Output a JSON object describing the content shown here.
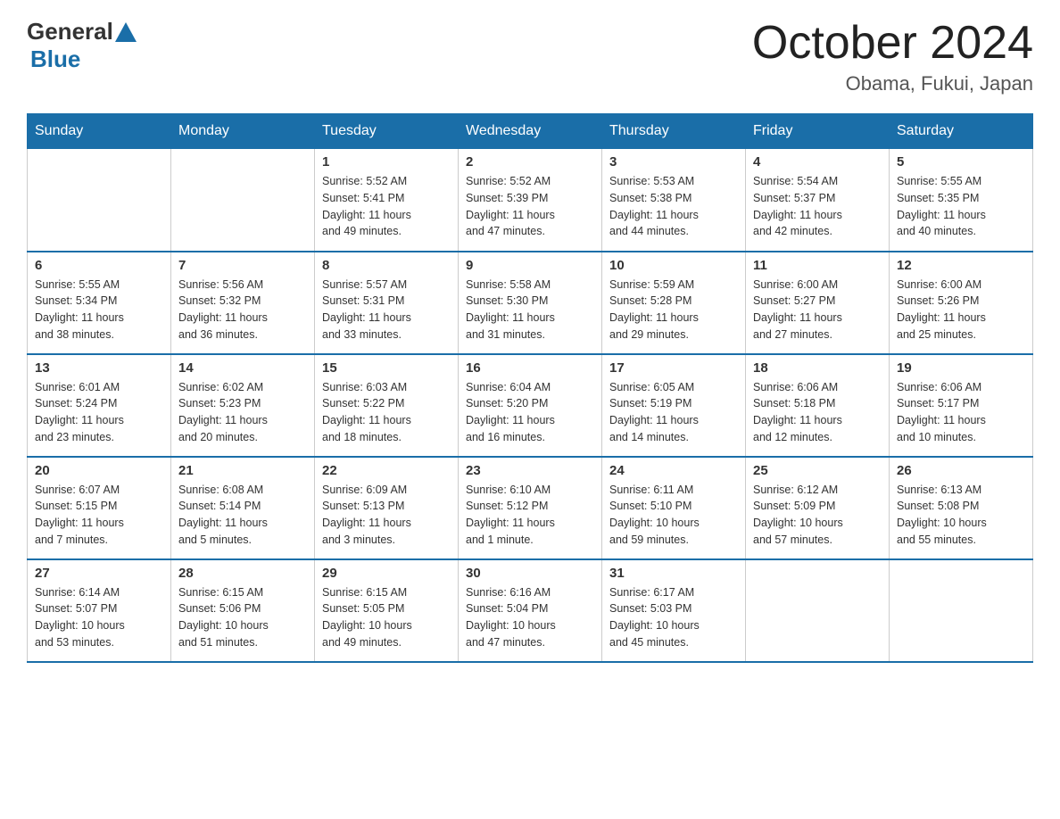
{
  "header": {
    "logo_general": "General",
    "logo_blue": "Blue",
    "month_year": "October 2024",
    "location": "Obama, Fukui, Japan"
  },
  "weekdays": [
    "Sunday",
    "Monday",
    "Tuesday",
    "Wednesday",
    "Thursday",
    "Friday",
    "Saturday"
  ],
  "weeks": [
    [
      {
        "day": "",
        "info": ""
      },
      {
        "day": "",
        "info": ""
      },
      {
        "day": "1",
        "info": "Sunrise: 5:52 AM\nSunset: 5:41 PM\nDaylight: 11 hours\nand 49 minutes."
      },
      {
        "day": "2",
        "info": "Sunrise: 5:52 AM\nSunset: 5:39 PM\nDaylight: 11 hours\nand 47 minutes."
      },
      {
        "day": "3",
        "info": "Sunrise: 5:53 AM\nSunset: 5:38 PM\nDaylight: 11 hours\nand 44 minutes."
      },
      {
        "day": "4",
        "info": "Sunrise: 5:54 AM\nSunset: 5:37 PM\nDaylight: 11 hours\nand 42 minutes."
      },
      {
        "day": "5",
        "info": "Sunrise: 5:55 AM\nSunset: 5:35 PM\nDaylight: 11 hours\nand 40 minutes."
      }
    ],
    [
      {
        "day": "6",
        "info": "Sunrise: 5:55 AM\nSunset: 5:34 PM\nDaylight: 11 hours\nand 38 minutes."
      },
      {
        "day": "7",
        "info": "Sunrise: 5:56 AM\nSunset: 5:32 PM\nDaylight: 11 hours\nand 36 minutes."
      },
      {
        "day": "8",
        "info": "Sunrise: 5:57 AM\nSunset: 5:31 PM\nDaylight: 11 hours\nand 33 minutes."
      },
      {
        "day": "9",
        "info": "Sunrise: 5:58 AM\nSunset: 5:30 PM\nDaylight: 11 hours\nand 31 minutes."
      },
      {
        "day": "10",
        "info": "Sunrise: 5:59 AM\nSunset: 5:28 PM\nDaylight: 11 hours\nand 29 minutes."
      },
      {
        "day": "11",
        "info": "Sunrise: 6:00 AM\nSunset: 5:27 PM\nDaylight: 11 hours\nand 27 minutes."
      },
      {
        "day": "12",
        "info": "Sunrise: 6:00 AM\nSunset: 5:26 PM\nDaylight: 11 hours\nand 25 minutes."
      }
    ],
    [
      {
        "day": "13",
        "info": "Sunrise: 6:01 AM\nSunset: 5:24 PM\nDaylight: 11 hours\nand 23 minutes."
      },
      {
        "day": "14",
        "info": "Sunrise: 6:02 AM\nSunset: 5:23 PM\nDaylight: 11 hours\nand 20 minutes."
      },
      {
        "day": "15",
        "info": "Sunrise: 6:03 AM\nSunset: 5:22 PM\nDaylight: 11 hours\nand 18 minutes."
      },
      {
        "day": "16",
        "info": "Sunrise: 6:04 AM\nSunset: 5:20 PM\nDaylight: 11 hours\nand 16 minutes."
      },
      {
        "day": "17",
        "info": "Sunrise: 6:05 AM\nSunset: 5:19 PM\nDaylight: 11 hours\nand 14 minutes."
      },
      {
        "day": "18",
        "info": "Sunrise: 6:06 AM\nSunset: 5:18 PM\nDaylight: 11 hours\nand 12 minutes."
      },
      {
        "day": "19",
        "info": "Sunrise: 6:06 AM\nSunset: 5:17 PM\nDaylight: 11 hours\nand 10 minutes."
      }
    ],
    [
      {
        "day": "20",
        "info": "Sunrise: 6:07 AM\nSunset: 5:15 PM\nDaylight: 11 hours\nand 7 minutes."
      },
      {
        "day": "21",
        "info": "Sunrise: 6:08 AM\nSunset: 5:14 PM\nDaylight: 11 hours\nand 5 minutes."
      },
      {
        "day": "22",
        "info": "Sunrise: 6:09 AM\nSunset: 5:13 PM\nDaylight: 11 hours\nand 3 minutes."
      },
      {
        "day": "23",
        "info": "Sunrise: 6:10 AM\nSunset: 5:12 PM\nDaylight: 11 hours\nand 1 minute."
      },
      {
        "day": "24",
        "info": "Sunrise: 6:11 AM\nSunset: 5:10 PM\nDaylight: 10 hours\nand 59 minutes."
      },
      {
        "day": "25",
        "info": "Sunrise: 6:12 AM\nSunset: 5:09 PM\nDaylight: 10 hours\nand 57 minutes."
      },
      {
        "day": "26",
        "info": "Sunrise: 6:13 AM\nSunset: 5:08 PM\nDaylight: 10 hours\nand 55 minutes."
      }
    ],
    [
      {
        "day": "27",
        "info": "Sunrise: 6:14 AM\nSunset: 5:07 PM\nDaylight: 10 hours\nand 53 minutes."
      },
      {
        "day": "28",
        "info": "Sunrise: 6:15 AM\nSunset: 5:06 PM\nDaylight: 10 hours\nand 51 minutes."
      },
      {
        "day": "29",
        "info": "Sunrise: 6:15 AM\nSunset: 5:05 PM\nDaylight: 10 hours\nand 49 minutes."
      },
      {
        "day": "30",
        "info": "Sunrise: 6:16 AM\nSunset: 5:04 PM\nDaylight: 10 hours\nand 47 minutes."
      },
      {
        "day": "31",
        "info": "Sunrise: 6:17 AM\nSunset: 5:03 PM\nDaylight: 10 hours\nand 45 minutes."
      },
      {
        "day": "",
        "info": ""
      },
      {
        "day": "",
        "info": ""
      }
    ]
  ]
}
